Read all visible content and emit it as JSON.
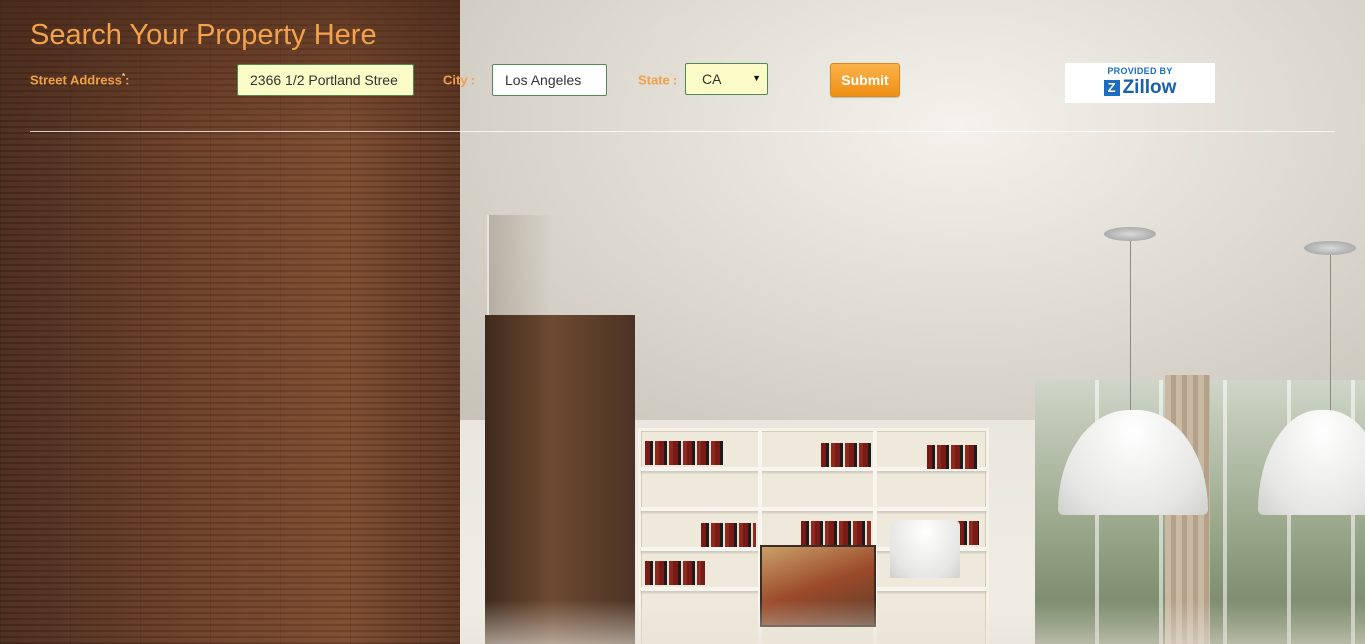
{
  "page": {
    "title": "Search Your Property Here"
  },
  "form": {
    "street": {
      "label": "Street Address",
      "required_mark": "*",
      "value": "2366 1/2 Portland Stree"
    },
    "city": {
      "label": "City",
      "required_mark": "*",
      "value": "Los Angeles"
    },
    "state": {
      "label": "State",
      "required_mark": "*",
      "selected": "CA"
    },
    "submit_label": "Submit"
  },
  "badge": {
    "provided_by": "PROVIDED BY",
    "brand": "Zillow",
    "mark": "Z"
  },
  "icons": {
    "state_caret": "dropdown-caret-icon",
    "zillow_logo": "zillow-logo-icon"
  },
  "colors": {
    "title": "#f3a24a",
    "label": "#f0a04a",
    "submit": "#ee8f15",
    "brand": "#1a5fae"
  }
}
